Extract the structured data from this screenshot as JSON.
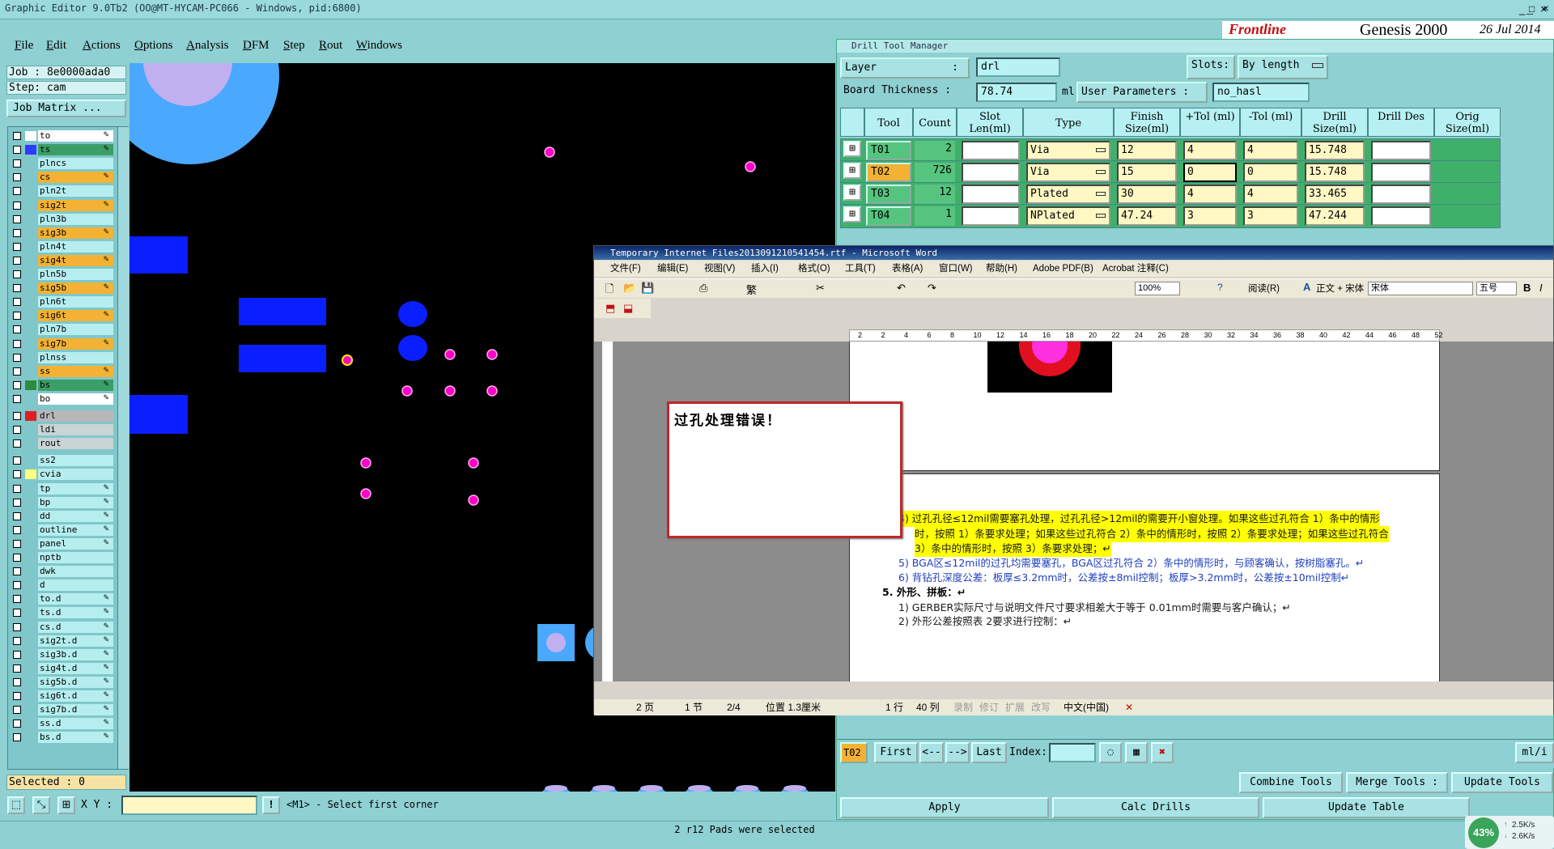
{
  "main_window": {
    "title": "Graphic Editor 9.0Tb2 (OO@MT-HYCAM-PC066 - Windows, pid:6800)",
    "menu": [
      "File",
      "Edit",
      "Actions",
      "Options",
      "Analysis",
      "DFM",
      "Step",
      "Rout",
      "Windows"
    ],
    "job_line": "Job : 8e0000ada0",
    "step_line": "Step: cam",
    "job_matrix_button": "Job Matrix ...",
    "selected_text": "Selected : 0",
    "xy_label": "X Y :",
    "xy_value": "",
    "prompt_text": "<M1> - Select first corner",
    "status_text": "2 r12 Pads were selected",
    "colors": {
      "bg": "#8fd0d3",
      "canvas": "#000000",
      "pad_blue": "#0a1fff",
      "drill_magenta": "#ff00c8",
      "highlight": "#f3b233"
    }
  },
  "brand": {
    "text": "Genesis 2000",
    "date": "26 Jul 2014"
  },
  "layers": [
    {
      "name": "to",
      "style": "wh",
      "swatch": "#ffffff",
      "edit": true
    },
    {
      "name": "ts",
      "style": "dk",
      "swatch": "#2d3cff",
      "edit": true
    },
    {
      "name": "plncs",
      "style": "",
      "swatch": "",
      "edit": false
    },
    {
      "name": "cs",
      "style": "hl",
      "swatch": "",
      "edit": true
    },
    {
      "name": "pln2t",
      "style": "",
      "swatch": "",
      "edit": false
    },
    {
      "name": "sig2t",
      "style": "hl",
      "swatch": "",
      "edit": true
    },
    {
      "name": "pln3b",
      "style": "",
      "swatch": "",
      "edit": false
    },
    {
      "name": "sig3b",
      "style": "hl",
      "swatch": "",
      "edit": true
    },
    {
      "name": "pln4t",
      "style": "",
      "swatch": "",
      "edit": false
    },
    {
      "name": "sig4t",
      "style": "hl",
      "swatch": "",
      "edit": true
    },
    {
      "name": "pln5b",
      "style": "",
      "swatch": "",
      "edit": false
    },
    {
      "name": "sig5b",
      "style": "hl",
      "swatch": "",
      "edit": true
    },
    {
      "name": "pln6t",
      "style": "",
      "swatch": "",
      "edit": false
    },
    {
      "name": "sig6t",
      "style": "hl",
      "swatch": "",
      "edit": true
    },
    {
      "name": "pln7b",
      "style": "",
      "swatch": "",
      "edit": false
    },
    {
      "name": "sig7b",
      "style": "hl",
      "swatch": "",
      "edit": true
    },
    {
      "name": "plnss",
      "style": "",
      "swatch": "",
      "edit": false
    },
    {
      "name": "ss",
      "style": "hl",
      "swatch": "",
      "edit": true
    },
    {
      "name": "bs",
      "style": "dk",
      "swatch": "#2e8b3a",
      "edit": true
    },
    {
      "name": "bo",
      "style": "wh",
      "swatch": "",
      "edit": true
    },
    {
      "name": "drl",
      "style": "gr",
      "swatch": "#e02020",
      "edit": false
    },
    {
      "name": "ldi",
      "style": "gl",
      "swatch": "",
      "edit": false
    },
    {
      "name": "rout",
      "style": "gl",
      "swatch": "",
      "edit": false
    },
    {
      "name": "ss2",
      "style": "",
      "swatch": "",
      "edit": false
    },
    {
      "name": "cvia",
      "style": "",
      "swatch": "#ffff80",
      "edit": false
    },
    {
      "name": "tp",
      "style": "",
      "swatch": "",
      "edit": true
    },
    {
      "name": "bp",
      "style": "",
      "swatch": "",
      "edit": true
    },
    {
      "name": "dd",
      "style": "",
      "swatch": "",
      "edit": true
    },
    {
      "name": "outline",
      "style": "",
      "swatch": "",
      "edit": true
    },
    {
      "name": "panel",
      "style": "",
      "swatch": "",
      "edit": true
    },
    {
      "name": "nptb",
      "style": "",
      "swatch": "",
      "edit": false
    },
    {
      "name": "dwk",
      "style": "",
      "swatch": "",
      "edit": false
    },
    {
      "name": "d",
      "style": "",
      "swatch": "",
      "edit": false
    },
    {
      "name": "to.d",
      "style": "",
      "swatch": "",
      "edit": true
    },
    {
      "name": "ts.d",
      "style": "",
      "swatch": "",
      "edit": true
    },
    {
      "name": "cs.d",
      "style": "",
      "swatch": "",
      "edit": true
    },
    {
      "name": "sig2t.d",
      "style": "",
      "swatch": "",
      "edit": true
    },
    {
      "name": "sig3b.d",
      "style": "",
      "swatch": "",
      "edit": true
    },
    {
      "name": "sig4t.d",
      "style": "",
      "swatch": "",
      "edit": true
    },
    {
      "name": "sig5b.d",
      "style": "",
      "swatch": "",
      "edit": true
    },
    {
      "name": "sig6t.d",
      "style": "",
      "swatch": "",
      "edit": true
    },
    {
      "name": "sig7b.d",
      "style": "",
      "swatch": "",
      "edit": true
    },
    {
      "name": "ss.d",
      "style": "",
      "swatch": "",
      "edit": true
    },
    {
      "name": "bs.d",
      "style": "",
      "swatch": "",
      "edit": true
    }
  ],
  "drill_tool_manager": {
    "title": "Drill Tool Manager",
    "layer_label": "Layer",
    "layer_colon": ":",
    "layer_value": "drl",
    "slots_label": "Slots:",
    "slots_value": "By length",
    "thickness_label": "Board Thickness :",
    "thickness_value": "78.74",
    "thickness_unit": "ml",
    "user_params_label": "User Parameters :",
    "user_params_value": "no_hasl",
    "headers": [
      "Tool",
      "Count",
      "Slot Len(ml)",
      "Type",
      "Finish Size(ml)",
      "+Tol (ml)",
      "-Tol (ml)",
      "Drill Size(ml)",
      "Drill Des",
      "Orig Size(ml)"
    ],
    "rows": [
      {
        "tool": "T01",
        "count": "2",
        "type": "Via",
        "finish": "12",
        "ptol": "4",
        "ntol": "4",
        "drill": "15.748",
        "selected": false
      },
      {
        "tool": "T02",
        "count": "726",
        "type": "Via",
        "finish": "15",
        "ptol": "0",
        "ntol": "0",
        "drill": "15.748",
        "selected": true
      },
      {
        "tool": "T03",
        "count": "12",
        "type": "Plated",
        "finish": "30",
        "ptol": "4",
        "ntol": "4",
        "drill": "33.465",
        "selected": false
      },
      {
        "tool": "T04",
        "count": "1",
        "type": "NPlated",
        "finish": "47.24",
        "ptol": "3",
        "ntol": "3",
        "drill": "47.244",
        "selected": false
      }
    ],
    "current_tool": "T02",
    "nav": {
      "first": "First",
      "prev": "<--",
      "next": "-->",
      "last": "Last",
      "index_label": "Index:"
    },
    "unit_btn": "ml/i",
    "combine": "Combine Tools",
    "merge": "Merge Tools :",
    "update_tools": "Update Tools",
    "apply": "Apply",
    "calc": "Calc Drills",
    "update_table": "Update Table",
    "net": {
      "percent": "43%",
      "up": "2.5K/s",
      "down": "2.6K/s"
    }
  },
  "word": {
    "title": "Temporary Internet Files2013091210541454.rtf - Microsoft Word",
    "menu": [
      "文件(F)",
      "编辑(E)",
      "视图(V)",
      "插入(I)",
      "格式(O)",
      "工具(T)",
      "表格(A)",
      "窗口(W)",
      "帮助(H)",
      "Adobe PDF(B)",
      "Acrobat 注释(C)"
    ],
    "zoom": "100%",
    "read_btn": "阅读(R)",
    "style": "正文 + 宋体",
    "font": "宋体",
    "size": "五号",
    "ruler": [
      "2",
      "2",
      "4",
      "6",
      "8",
      "10",
      "12",
      "14",
      "16",
      "18",
      "20",
      "22",
      "24",
      "26",
      "28",
      "30",
      "32",
      "34",
      "36",
      "38",
      "40",
      "42",
      "44",
      "46",
      "48",
      "52"
    ],
    "lines": [
      {
        "text": "4)  过孔孔径≤12mil需要塞孔处理，过孔孔径>12mil的需要开小窗处理。如果这些过孔符合 1）条中的情形",
        "color": "#1a1a1a",
        "hl": true
      },
      {
        "text": "时，按照 1）条要求处理；如果这些过孔符合 2）条中的情形时，按照 2）条要求处理；如果这些过孔符合",
        "color": "#1a1a1a",
        "hl": true
      },
      {
        "text": "3）条中的情形时，按照 3）条要求处理；↵",
        "color": "#1a1a1a",
        "hl": true
      },
      {
        "text": "5) BGA区≤12mil的过孔均需要塞孔，BGA区过孔符合 2）条中的情形时，与顾客确认，按树脂塞孔。↵",
        "color": "#1f3fbf",
        "hl": false
      },
      {
        "text": "6) 背钻孔深度公差：板厚≤3.2mm时，公差按±8mil控制；板厚>3.2mm时，公差按±10mil控制↵",
        "color": "#1f3fbf",
        "hl": false
      },
      {
        "text": "5.   外形、拼板：↵",
        "color": "#000",
        "hl": false,
        "bold": true
      },
      {
        "text": "1)  GERBER实际尺寸与说明文件尺寸要求相差大于等于 0.01mm时需要与客户确认；↵",
        "color": "#1a1a1a",
        "hl": false
      },
      {
        "text": "2)  外形公差按照表 2要求进行控制：↵",
        "color": "#1a1a1a",
        "hl": false
      }
    ],
    "status": {
      "page": "2 页",
      "section": "1 节",
      "pages": "2/4",
      "pos": "位置 1.3厘米",
      "line": "1 行",
      "col": "40 列",
      "rec": "录制",
      "trk": "修订",
      "ext": "扩展",
      "ovr": "改写",
      "lang": "中文(中国)"
    }
  },
  "popup": {
    "text": "过孔处理错误！"
  }
}
